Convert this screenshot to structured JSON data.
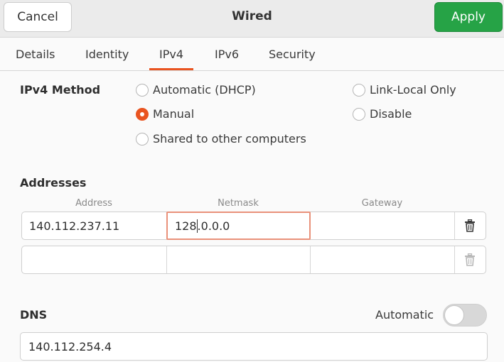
{
  "header": {
    "cancel_label": "Cancel",
    "title": "Wired",
    "apply_label": "Apply"
  },
  "tabs": [
    {
      "label": "Details",
      "active": false
    },
    {
      "label": "Identity",
      "active": false
    },
    {
      "label": "IPv4",
      "active": true
    },
    {
      "label": "IPv6",
      "active": false
    },
    {
      "label": "Security",
      "active": false
    }
  ],
  "ipv4_method": {
    "label": "IPv4 Method",
    "options": [
      {
        "label": "Automatic (DHCP)",
        "selected": false
      },
      {
        "label": "Link-Local Only",
        "selected": false
      },
      {
        "label": "Manual",
        "selected": true
      },
      {
        "label": "Disable",
        "selected": false
      },
      {
        "label": "Shared to other computers",
        "selected": false
      }
    ]
  },
  "addresses": {
    "label": "Addresses",
    "columns": [
      "Address",
      "Netmask",
      "Gateway"
    ],
    "rows": [
      {
        "address": "140.112.237.11",
        "netmask_before_caret": "128",
        "netmask_after_caret": ".0.0.0",
        "gateway": ""
      },
      {
        "address": "",
        "netmask": "",
        "gateway": ""
      }
    ]
  },
  "dns": {
    "label": "DNS",
    "automatic_label": "Automatic",
    "automatic_on": false,
    "value": "140.112.254.4"
  },
  "colors": {
    "accent": "#e95420",
    "apply_green": "#26a346"
  },
  "icons": {
    "delete": "trash-icon"
  }
}
